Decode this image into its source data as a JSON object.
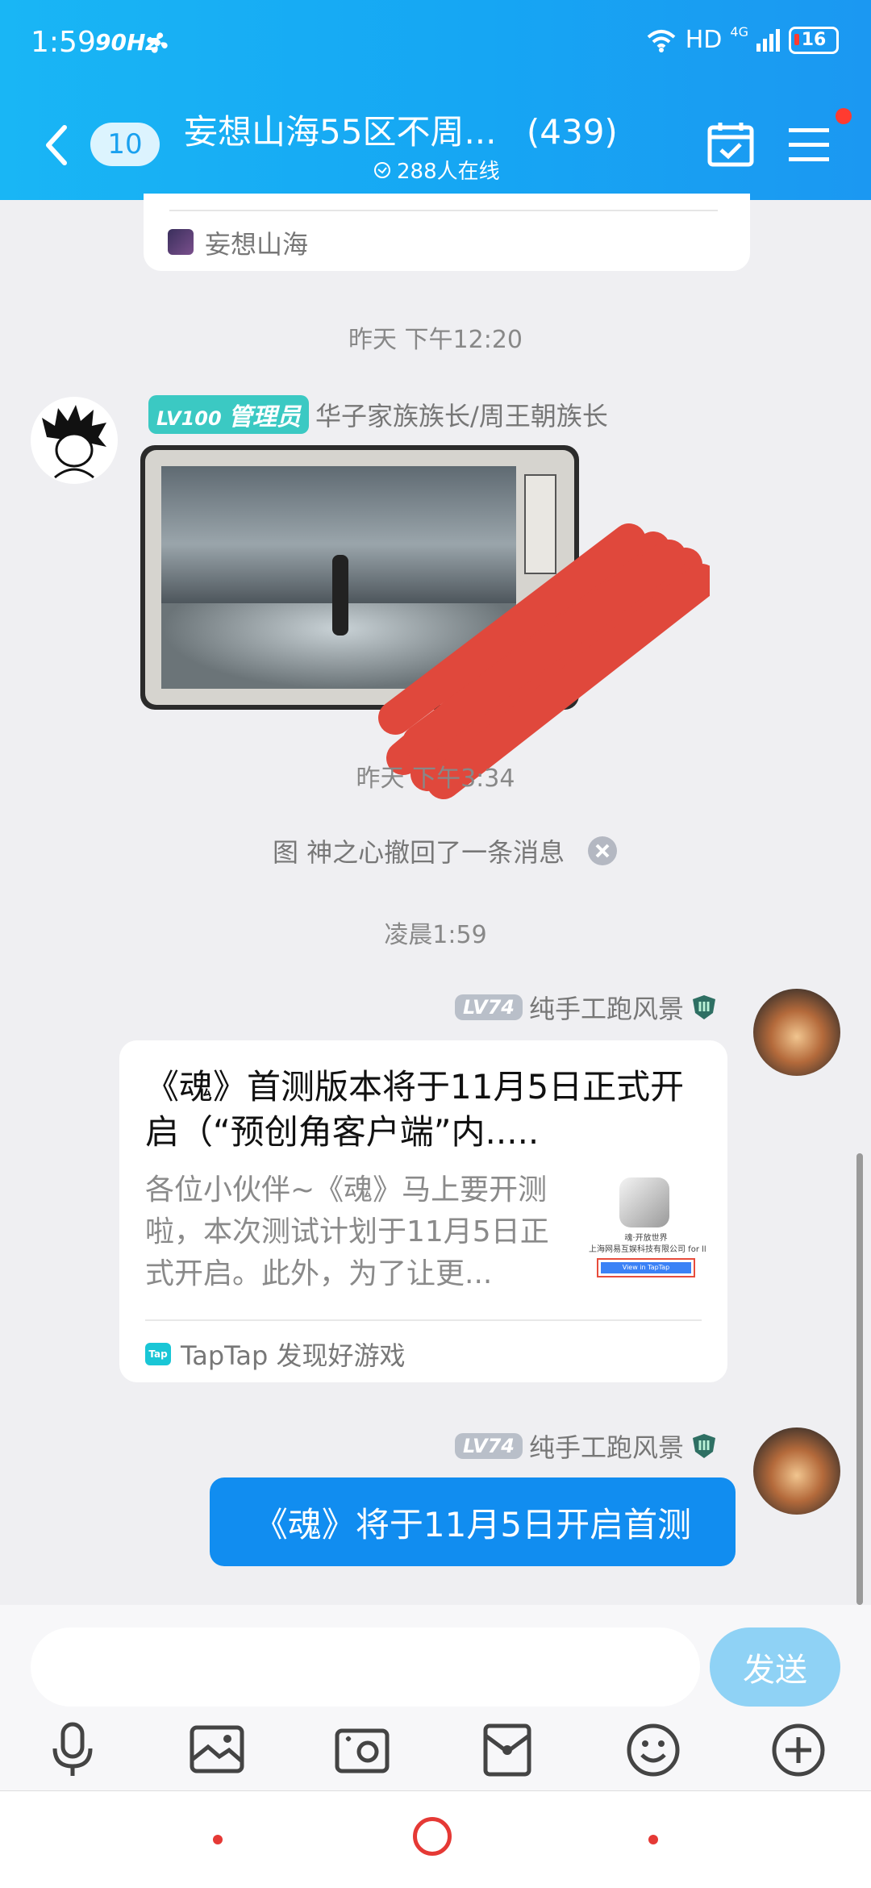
{
  "status_bar": {
    "time": "1:59",
    "refresh_rate": "90Hz",
    "network": "HD",
    "signal": "4G",
    "battery": "16"
  },
  "header": {
    "unread_count": "10",
    "group_name": "妄想山海55区不周...",
    "member_count": "(439)",
    "online": "288人在线"
  },
  "chat": {
    "prev_card_source": "妄想山海",
    "ts1": "昨天 下午12:20",
    "msg1": {
      "level": "LV100",
      "role": "管理员",
      "sender": "华子家族族长/周王朝族长"
    },
    "ts2": "昨天 下午3:34",
    "recall_notice": "图 神之心撤回了一条消息",
    "ts3": "凌晨1:59",
    "msg2": {
      "level": "LV74",
      "sender": "纯手工跑风景",
      "card_title": "《魂》首测版本将于11月5日正式开启（“预创角客户端”内.....",
      "card_desc": "各位小伙伴~《魂》马上要开测啦，本次测试计划于11月5日正式开启。此外，为了让更...",
      "thumb_line1": "魂·开放世界",
      "thumb_line2": "上海网易互娱科技有限公司 for ll",
      "thumb_button": "View in TapTap",
      "card_source_icon": "Tap",
      "card_source": "TapTap 发现好游戏"
    },
    "msg3": {
      "level": "LV74",
      "sender": "纯手工跑风景",
      "text": "《魂》将于11月5日开启首测"
    }
  },
  "input": {
    "placeholder": "",
    "send_label": "发送"
  },
  "toolbar": [
    "microphone-icon",
    "image-icon",
    "camera-icon",
    "red-packet-icon",
    "emoji-icon",
    "plus-icon"
  ],
  "colors": {
    "header": "#18a9f4",
    "bubble": "#118df0",
    "send_disabled": "#8fd2f5",
    "admin_badge": "#3bc9c3",
    "redaction": "#e0483c"
  }
}
